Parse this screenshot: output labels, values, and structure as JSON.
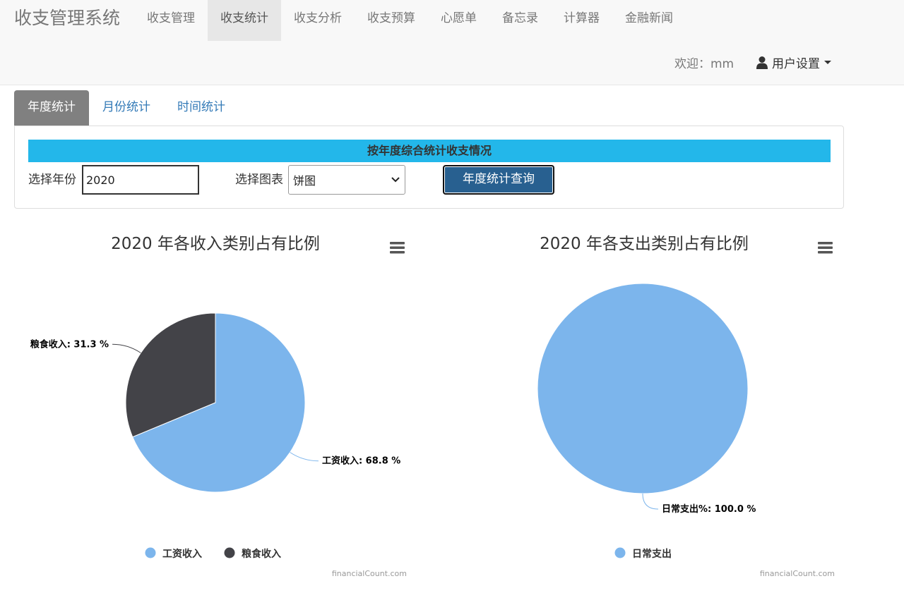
{
  "nav": {
    "brand": "收支管理系统",
    "items": [
      "收支管理",
      "收支统计",
      "收支分析",
      "收支预算",
      "心愿单",
      "备忘录",
      "计算器",
      "金融新闻"
    ],
    "active_index": 1,
    "welcome": "欢迎：mm",
    "user_settings": "用户设置"
  },
  "tabs": {
    "items": [
      "年度统计",
      "月份统计",
      "时间统计"
    ],
    "active_index": 0
  },
  "panel": {
    "title": "按年度综合统计收支情况",
    "year_label": "选择年份",
    "year_value": "2020",
    "chart_label": "选择图表",
    "chart_value": "饼图",
    "query_button": "年度统计查询"
  },
  "chart_data": [
    {
      "type": "pie",
      "title": "2020 年各收入类别占有比例",
      "credits": "financialCount.com",
      "menu_icon": "hamburger-menu-icon",
      "series": [
        {
          "name": "工资收入",
          "value": 68.8,
          "color": "#7cb5ec",
          "label": "工资收入: 68.8 %"
        },
        {
          "name": "粮食收入",
          "value": 31.3,
          "color": "#434348",
          "label": "粮食收入: 31.3 %"
        }
      ],
      "legend": [
        "工资收入",
        "粮食收入"
      ],
      "legend_placement": "bottom-center"
    },
    {
      "type": "pie",
      "title": "2020 年各支出类别占有比例",
      "credits": "financialCount.com",
      "menu_icon": "hamburger-menu-icon",
      "series": [
        {
          "name": "日常支出",
          "value": 100.0,
          "color": "#7cb5ec",
          "label": "日常支出%: 100.0 %"
        }
      ],
      "legend": [
        "日常支出"
      ],
      "legend_placement": "bottom-center"
    }
  ]
}
